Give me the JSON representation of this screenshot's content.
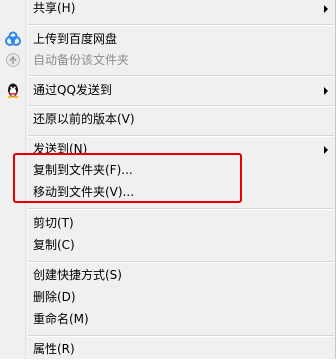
{
  "menu": {
    "items": {
      "share": {
        "label": "共享(H)"
      },
      "upload_baidu": {
        "label": "上传到百度网盘"
      },
      "auto_backup": {
        "label": "自动备份该文件夹"
      },
      "send_qq": {
        "label": "通过QQ发送到"
      },
      "restore_prev": {
        "label": "还原以前的版本(V)"
      },
      "send_to": {
        "label": "发送到(N)"
      },
      "copy_to_folder": {
        "label": "复制到文件夹(F)..."
      },
      "move_to_folder": {
        "label": "移动到文件夹(V)..."
      },
      "cut": {
        "label": "剪切(T)"
      },
      "copy": {
        "label": "复制(C)"
      },
      "create_shortcut": {
        "label": "创建快捷方式(S)"
      },
      "delete": {
        "label": "删除(D)"
      },
      "rename": {
        "label": "重命名(M)"
      },
      "properties": {
        "label": "属性(R)"
      }
    }
  },
  "colors": {
    "highlight_border": "#e60000",
    "menu_background": "#f0f0f0",
    "disabled_text": "#8d8d8d"
  },
  "icons": {
    "baidu": "baidu-netdisk-icon",
    "backup": "backup-icon",
    "qq": "qq-penguin-icon"
  }
}
